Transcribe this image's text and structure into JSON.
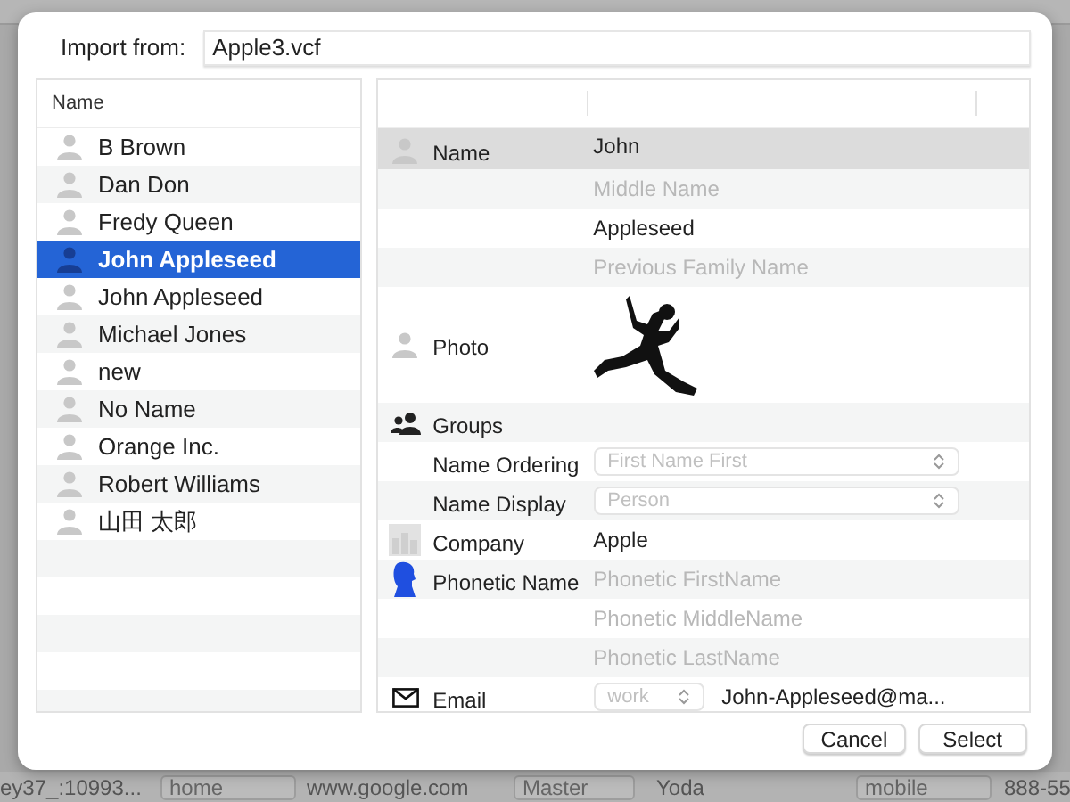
{
  "background": {
    "row": {
      "id": "ey37_:10993...",
      "label_type": "home",
      "url": "www.google.com",
      "group": "Master",
      "name": "Yoda",
      "phone_type": "mobile",
      "phone": "888-55"
    }
  },
  "dialog": {
    "import_label": "Import from:",
    "import_file": "Apple3.vcf",
    "list": {
      "header": "Name",
      "items": [
        {
          "name": "B Brown",
          "selected": false
        },
        {
          "name": "Dan Don",
          "selected": false
        },
        {
          "name": "Fredy Queen",
          "selected": false
        },
        {
          "name": "John Appleseed",
          "selected": true
        },
        {
          "name": "John Appleseed",
          "selected": false
        },
        {
          "name": "Michael Jones",
          "selected": false
        },
        {
          "name": "new",
          "selected": false
        },
        {
          "name": "No Name",
          "selected": false
        },
        {
          "name": "Orange Inc.",
          "selected": false
        },
        {
          "name": "Robert Williams",
          "selected": false
        },
        {
          "name": "山田 太郎",
          "selected": false
        }
      ]
    },
    "detail": {
      "rows": [
        {
          "kind": "text",
          "label": "Name",
          "value": "John",
          "selected": true
        },
        {
          "kind": "text",
          "placeholder": "Middle Name",
          "selected": false
        },
        {
          "kind": "text",
          "value": "Appleseed",
          "selected": false
        },
        {
          "kind": "text",
          "placeholder": "Previous Family Name",
          "selected": false
        },
        {
          "label": "Photo",
          "selected": false
        },
        {
          "kind": "text",
          "label": "Groups",
          "selected": false
        },
        {
          "kind": "select",
          "label": "Name Ordering",
          "placeholder": "First Name First",
          "selected": false
        },
        {
          "kind": "select",
          "label": "Name Display",
          "placeholder": "Person",
          "selected": false
        },
        {
          "kind": "text",
          "label": "Company",
          "value": "Apple",
          "selected": false
        },
        {
          "kind": "text",
          "label": "Phonetic Name",
          "placeholder": "Phonetic FirstName",
          "selected": false
        },
        {
          "kind": "text",
          "placeholder": "Phonetic MiddleName",
          "selected": false
        },
        {
          "kind": "text",
          "placeholder": "Phonetic LastName",
          "selected": false
        },
        {
          "kind": "email",
          "label": "Email",
          "type": "work",
          "value": "John-Appleseed@ma...",
          "selected": false
        }
      ]
    }
  },
  "buttons": [
    "Cancel",
    "Select"
  ]
}
